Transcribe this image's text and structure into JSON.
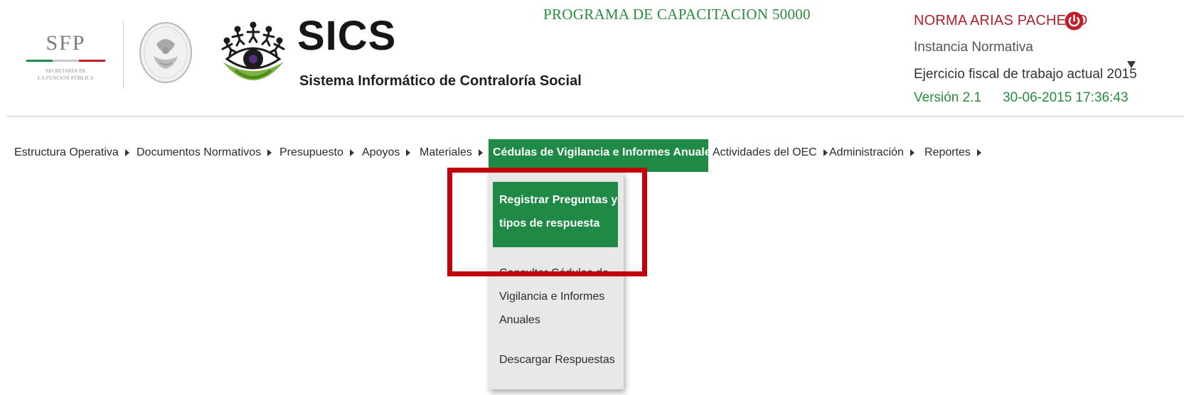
{
  "colors": {
    "brand_green": "#1e8a45",
    "program_green": "#2b8a3e",
    "user_red": "#b01e2c",
    "highlight_red": "#c0000b",
    "dropdown_bg": "#e8e8e8"
  },
  "header": {
    "sfp_logo": {
      "text": "SFP",
      "subtitle_line1": "SECRETARÍA DE",
      "subtitle_line2": "LA FUNCIÓN PÚBLICA"
    },
    "seal_icon": "mexico-coat-of-arms-seal",
    "sics_icon": "sics-people-circle-eye-emblem",
    "app_title": "SICS",
    "app_subtitle": "Sistema Informático de Contraloría Social",
    "program_title": "PROGRAMA DE CAPACITACION 50000",
    "user": {
      "name": "NORMA ARIAS PACHECO",
      "logout_icon": "power-icon",
      "role": "Instancia Normativa",
      "fiscal_label": "Ejercicio fiscal de trabajo actual",
      "fiscal_year": "2015",
      "version": "Versión 2.1",
      "datetime": "30-06-2015 17:36:43",
      "menu_toggle_icon": "chevron-down-icon"
    }
  },
  "menu": {
    "items": [
      {
        "label": "Estructura Operativa"
      },
      {
        "label": "Documentos Normativos"
      },
      {
        "label": "Presupuesto"
      },
      {
        "label": "Apoyos"
      },
      {
        "label": "Materiales"
      },
      {
        "label": "Cédulas de Vigilancia e Informes Anuales"
      },
      {
        "label": "Actividades del OEC"
      },
      {
        "label": "Administración"
      },
      {
        "label": "Reportes"
      }
    ],
    "active_index": 5
  },
  "dropdown": {
    "items": [
      {
        "line1": "Registrar Preguntas y",
        "line2": "tipos de respuesta"
      },
      {
        "line1": "Consultar Cédulas de",
        "line2": "Vigilancia e Informes",
        "line3": "Anuales"
      },
      {
        "line1": "Descargar Respuestas"
      }
    ],
    "selected_index": 0
  }
}
